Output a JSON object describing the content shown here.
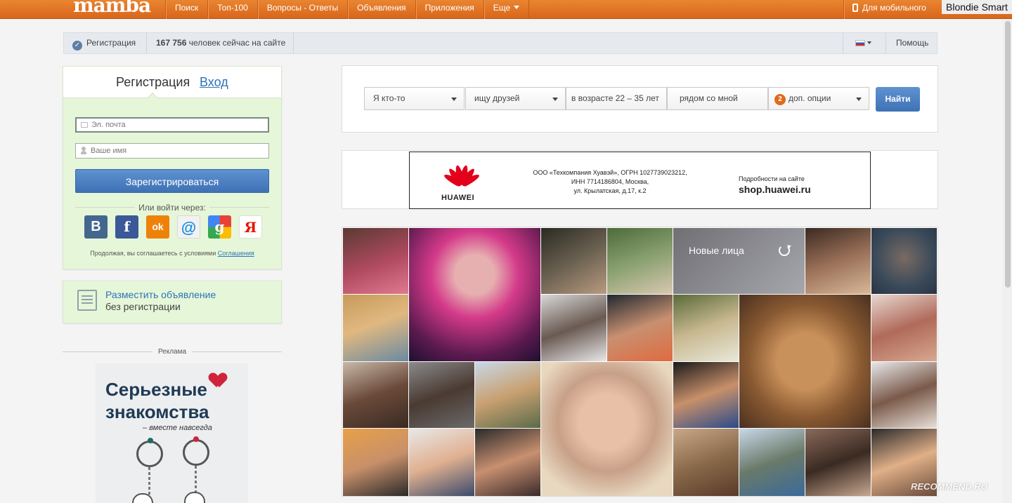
{
  "topbar": {
    "logo": "mamba",
    "nav": [
      "Поиск",
      "Топ-100",
      "Вопросы - Ответы",
      "Объявления",
      "Приложения"
    ],
    "more_label": "Еще",
    "mobile_label": "Для мобильного",
    "user_label": "Blondie Smart"
  },
  "statusbar": {
    "registration_label": "Регистрация",
    "online_count": "167 756",
    "online_text": "человек сейчас на сайте",
    "help_label": "Помощь"
  },
  "register": {
    "tab_register": "Регистрация",
    "tab_login": "Вход",
    "email_placeholder": "Эл. почта",
    "name_placeholder": "Ваше имя",
    "submit_label": "Зарегистрироваться",
    "or_label": "Или войти через:",
    "social": [
      "В",
      "f",
      "ok",
      "@",
      "g",
      "Я"
    ],
    "terms_text": "Продолжая, вы соглашаетесь с условиями",
    "terms_link": "Соглашения"
  },
  "ad_box": {
    "title": "Разместить объявление",
    "subtitle": "без регистрации"
  },
  "promo": {
    "label": "Реклама",
    "line1": "Серьезные",
    "line2": "знакомства",
    "line3": "– вместе навсегда"
  },
  "search": {
    "who": "Я кто-то",
    "seeking": "ищу друзей",
    "age": "в возрасте 22 – 35  лет",
    "location": "рядом со мной",
    "extra_count": "2",
    "extra_label": "доп. опции",
    "submit_label": "Найти"
  },
  "banner": {
    "brand": "HUAWEI",
    "legal_line1": "ООО «Техкомпания Хуавэй», ОГРН 1027739023212,",
    "legal_line2": "ИНН 7714186804, Москва,",
    "legal_line3": "ул. Крылатская, д.17, к.2",
    "details_label": "Подробности на сайте",
    "details_site": "shop.huawei.ru"
  },
  "photos": {
    "new_faces_label": "Новые лица"
  },
  "watermark": "RECOMMEND.RU",
  "colors": {
    "brand_orange": "#e07a2a",
    "accent_blue": "#4a7fc1",
    "card_green": "#e6f6d8"
  }
}
